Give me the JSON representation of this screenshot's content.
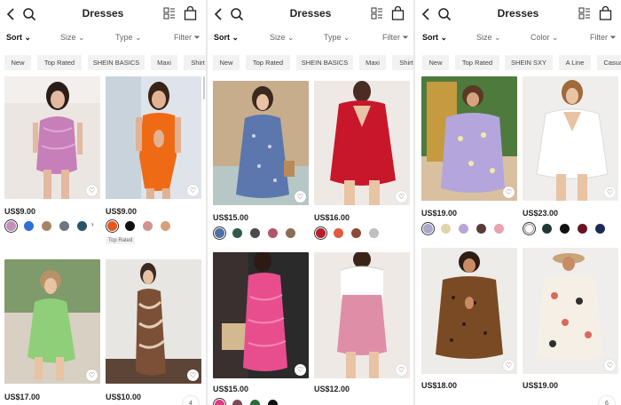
{
  "panels": [
    {
      "title": "Dresses",
      "filters": {
        "sort": "Sort",
        "f1": "Size",
        "f2": "Type",
        "filter": "Filter"
      },
      "chips": [
        "New",
        "Top Rated",
        "SHEIN BASICS",
        "Maxi",
        "Shirt"
      ],
      "products": [
        {
          "price": "US$9.00",
          "swatches": [
            "#c490b8",
            "#2f6fd6",
            "#a88466",
            "#6d7780",
            "#2b5364"
          ],
          "badge": ""
        },
        {
          "price": "US$9.00",
          "swatches": [
            "#e7561c",
            "#111111",
            "#d1948a",
            "#d7a07d",
            "#f0c8a8"
          ],
          "badge": "Top Rated"
        },
        {
          "price": "US$17.00",
          "swatches": [],
          "badge": ""
        },
        {
          "price": "US$10.00",
          "swatches": [],
          "badge": ""
        }
      ],
      "fab_text": "4"
    },
    {
      "title": "Dresses",
      "filters": {
        "sort": "Sort",
        "f1": "Size",
        "f2": "Type",
        "filter": "Filter"
      },
      "chips": [
        "New",
        "Top Rated",
        "SHEIN BASICS",
        "Maxi",
        "Shirt"
      ],
      "products": [
        {
          "price": "US$15.00",
          "swatches": [
            "#4d6fa3",
            "#2e5a4b",
            "#4a4a4a",
            "#b0566c",
            "#8b6e58"
          ],
          "badge": ""
        },
        {
          "price": "US$16.00",
          "swatches": [
            "#b41f2c",
            "#e05a3e",
            "#8b4a36",
            "#c0c0c0"
          ],
          "badge": ""
        },
        {
          "price": "US$15.00",
          "swatches": [
            "#e23b84",
            "#7b4a5a",
            "#2f6b3c",
            "#111111"
          ],
          "badge": ""
        },
        {
          "price": "US$12.00",
          "swatches": [],
          "badge": ""
        }
      ]
    },
    {
      "title": "Dresses",
      "filters": {
        "sort": "Sort",
        "f1": "Size",
        "f2": "Color",
        "filter": "Filter"
      },
      "chips": [
        "New",
        "Top Rated",
        "SHEIN SXY",
        "A Line",
        "Casual"
      ],
      "products": [
        {
          "price": "US$19.00",
          "swatches": [
            "#a9a9c8",
            "#e0d5a8",
            "#b8a6d6",
            "#5a3b3b",
            "#e8a2b0"
          ],
          "badge": ""
        },
        {
          "price": "US$23.00",
          "swatches": [
            "#ffffff",
            "#1f3a34",
            "#111111",
            "#6b1222",
            "#1a2a55"
          ],
          "badge": ""
        },
        {
          "price": "US$18.00",
          "swatches": [],
          "badge": ""
        },
        {
          "price": "US$19.00",
          "swatches": [],
          "badge": ""
        }
      ],
      "fab_text": "6"
    }
  ]
}
